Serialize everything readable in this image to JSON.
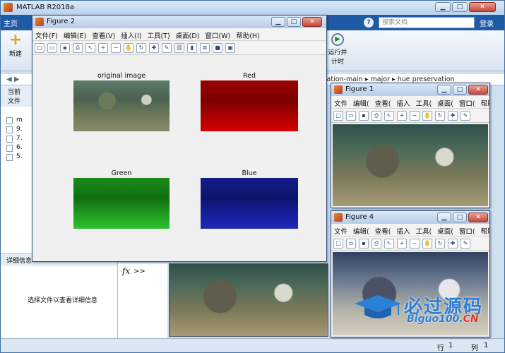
{
  "matlab": {
    "title": "MATLAB R2018a",
    "tab_home": "主页",
    "search_placeholder": "搜索文档",
    "login": "登录",
    "help_q": "?",
    "new_label": "新建",
    "run_label": "运行并\n计时",
    "address_path": "rvation-main  ▸  major  ▸  hue preservation",
    "current_folder_header": "当前文件",
    "files": [
      {
        "name": "m"
      },
      {
        "name": "9."
      },
      {
        "name": "7."
      },
      {
        "name": "6."
      },
      {
        "name": "5."
      }
    ],
    "details_header": "详细信息",
    "details_message": "选择文件以查看详细信息",
    "fx": "fx",
    "prompt": ">>",
    "status_row_label": "行",
    "status_row_value": "1",
    "status_col_label": "列",
    "status_col_value": "1"
  },
  "figure2": {
    "title": "Figure 2",
    "menu": [
      "文件(F)",
      "编辑(E)",
      "查看(V)",
      "插入(I)",
      "工具(T)",
      "桌面(D)",
      "窗口(W)",
      "帮助(H)"
    ],
    "subplots": [
      {
        "caption": "original image"
      },
      {
        "caption": "Red"
      },
      {
        "caption": "Green"
      },
      {
        "caption": "Blue"
      }
    ]
  },
  "figure1": {
    "title": "Figure 1",
    "menu": [
      "文件",
      "编辑(",
      "查看(",
      "插入",
      "工具(",
      "桌面(",
      "窗口(",
      "帮助("
    ]
  },
  "figure4": {
    "title": "Figure 4",
    "menu": [
      "文件",
      "编辑(",
      "查看(",
      "插入",
      "工具(",
      "桌面(",
      "窗口(",
      "帮助("
    ]
  },
  "watermark": {
    "zh": "必过源码",
    "en_prefix": "Biguo100.",
    "en_suffix": "CN"
  },
  "colors": {
    "toolstrip": "#1f5aa6",
    "red_channel": "#b30000",
    "green_channel": "#22a222",
    "blue_channel": "#171fa0",
    "watermark_blue": "#2b7fd6",
    "watermark_red": "#d93a2a"
  }
}
